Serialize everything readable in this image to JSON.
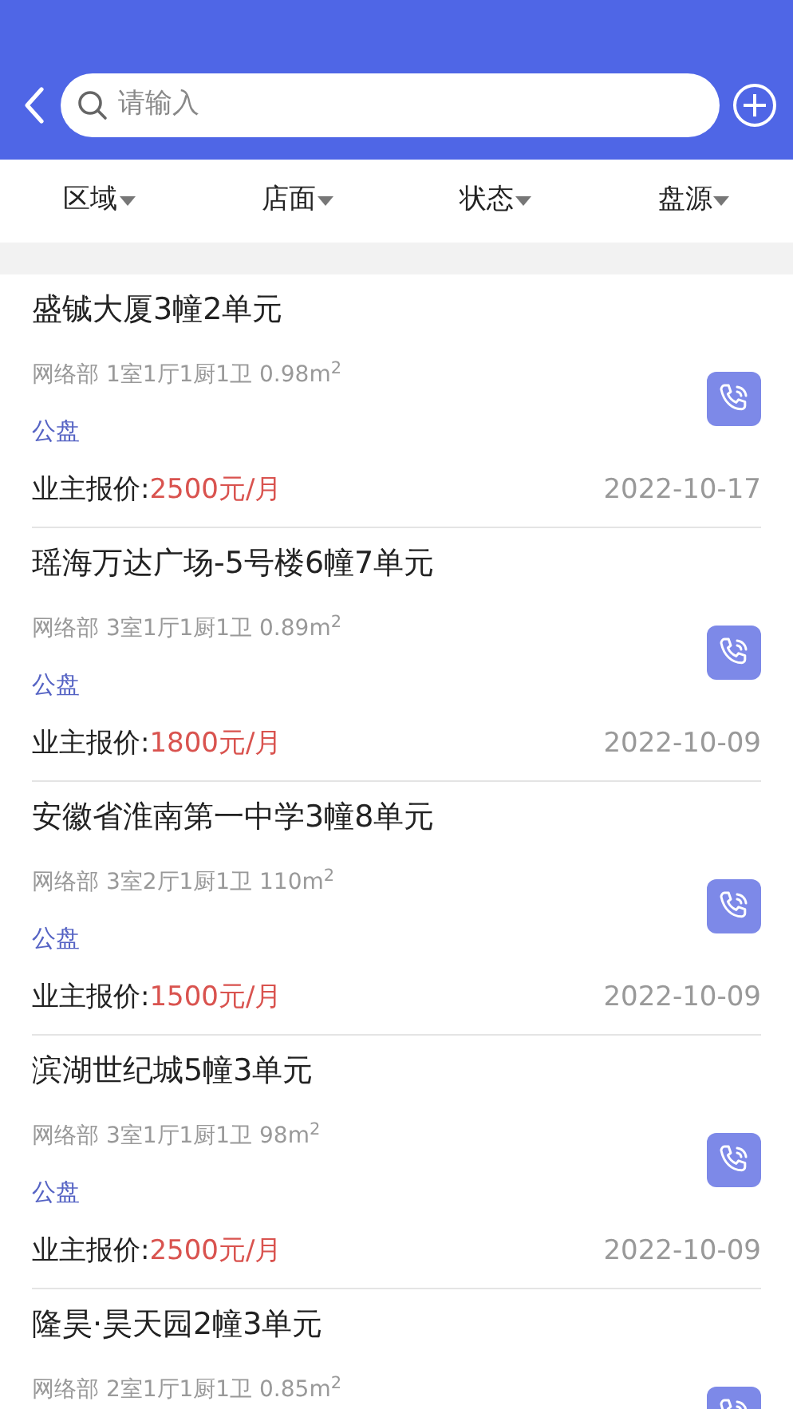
{
  "search": {
    "placeholder": "请输入"
  },
  "filters": [
    {
      "label": "区域"
    },
    {
      "label": "店面"
    },
    {
      "label": "状态"
    },
    {
      "label": "盘源"
    }
  ],
  "listings": [
    {
      "title": "盛铖大厦3幢2单元",
      "meta": "网络部 1室1厅1厨1卫 0.98m$^{2}$",
      "tag": "公盘",
      "price_label": "业主报价:",
      "price": "2500元/月",
      "date": "2022-10-17"
    },
    {
      "title": "瑶海万达广场-5号楼6幢7单元",
      "meta": "网络部 3室1厅1厨1卫 0.89m$^{2}$",
      "tag": "公盘",
      "price_label": "业主报价:",
      "price": "1800元/月",
      "date": "2022-10-09"
    },
    {
      "title": "安徽省淮南第一中学3幢8单元",
      "meta": "网络部 3室2厅1厨1卫 110m$^{2}$",
      "tag": "公盘",
      "price_label": "业主报价:",
      "price": "1500元/月",
      "date": "2022-10-09"
    },
    {
      "title": "滨湖世纪城5幢3单元",
      "meta": "网络部 3室1厅1厨1卫 98m$^{2}$",
      "tag": "公盘",
      "price_label": "业主报价:",
      "price": "2500元/月",
      "date": "2022-10-09"
    },
    {
      "title": "隆昊·昊天园2幢3单元",
      "meta": "网络部 2室1厅1厨1卫 0.85m$^{2}$"
    }
  ]
}
